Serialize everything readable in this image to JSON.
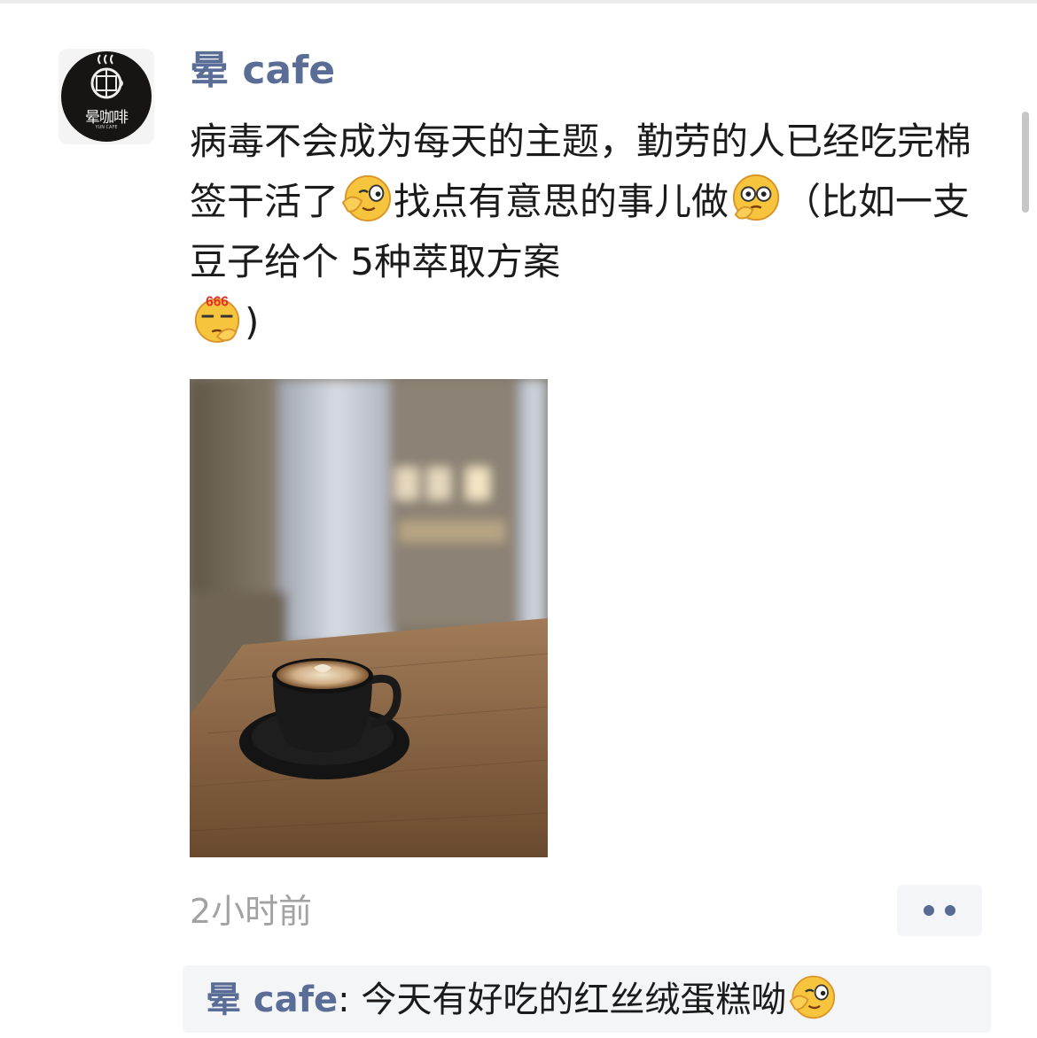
{
  "post": {
    "author": "晕 cafe",
    "avatar": {
      "logo_text": "晕咖啡",
      "logo_subtext": "YUN CAFE"
    },
    "text": {
      "part1": "病毒不会成为每天的主题，勤劳的人已经吃完棉签干活了",
      "part2": "找点有意思的事儿做",
      "part3": "（比如一支豆子给个 5种萃取方案",
      "part4": ")"
    },
    "emojis": {
      "first": "wink-emoji",
      "second": "thinking-emoji",
      "third": "666-emoji",
      "third_badge": "666"
    },
    "image": {
      "subject": "latte-cup-photo"
    },
    "timestamp": "2小时前",
    "more_icon": "more-dots-icon"
  },
  "comment": {
    "author": "晕 cafe",
    "separator": ": ",
    "text": "今天有好吃的红丝绒蛋糕呦",
    "emoji": "wink-emoji"
  },
  "colors": {
    "name_blue": "#5a6d96",
    "text": "#1b1b1b",
    "timestamp_gray": "#a2a2a2",
    "comment_bg": "#f4f5f7"
  }
}
